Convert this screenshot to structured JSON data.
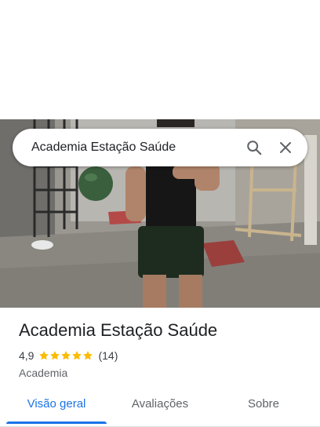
{
  "search": {
    "query": "Academia Estação Saúde"
  },
  "place": {
    "title": "Academia Estação Saúde",
    "rating": "4,9",
    "stars": 5,
    "review_count": "(14)",
    "category": "Academia"
  },
  "tabs": [
    {
      "label": "Visão geral",
      "active": true
    },
    {
      "label": "Avaliações",
      "active": false
    },
    {
      "label": "Sobre",
      "active": false
    }
  ],
  "colors": {
    "accent": "#1a73e8",
    "star": "#fbbc04",
    "text": "#202124",
    "muted": "#5f6368"
  },
  "icons": {
    "search": "search-icon",
    "close": "close-icon",
    "star": "star-icon"
  }
}
